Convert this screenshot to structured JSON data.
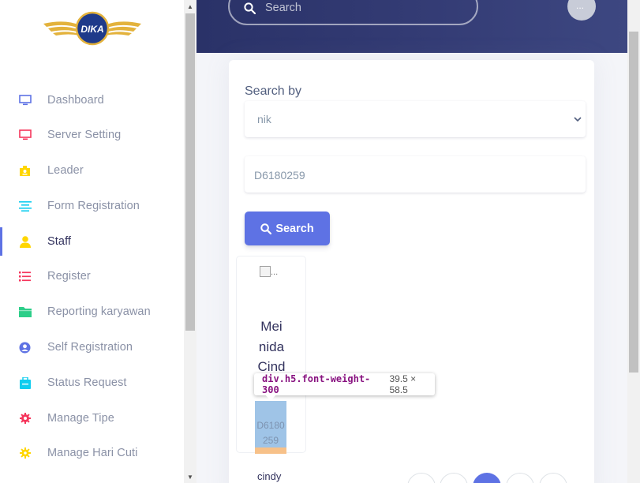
{
  "brand": {
    "logo_text": "DIKA"
  },
  "sidebar": {
    "items": [
      {
        "label": "Dashboard",
        "icon": "tv-icon",
        "color": "#5e72e4"
      },
      {
        "label": "Server Setting",
        "icon": "monitor-icon",
        "color": "#f5365c"
      },
      {
        "label": "Leader",
        "icon": "badge-icon",
        "color": "#ffd600"
      },
      {
        "label": "Form Registration",
        "icon": "align-center-icon",
        "color": "#11cdef"
      },
      {
        "label": "Staff",
        "icon": "user-icon",
        "color": "#ffd600",
        "active": true
      },
      {
        "label": "Register",
        "icon": "list-icon",
        "color": "#f5365c"
      },
      {
        "label": "Reporting karyawan",
        "icon": "folder-icon",
        "color": "#2dce89"
      },
      {
        "label": "Self Registration",
        "icon": "user-circle-icon",
        "color": "#5e72e4"
      },
      {
        "label": "Status Request",
        "icon": "briefcase-icon",
        "color": "#11cdef"
      },
      {
        "label": "Manage Tipe",
        "icon": "settings-gear-icon",
        "color": "#f5365c"
      },
      {
        "label": "Manage Hari Cuti",
        "icon": "sun-icon",
        "color": "#ffd600"
      }
    ]
  },
  "header": {
    "search_placeholder": "Search",
    "avatar_alt": "..."
  },
  "form": {
    "search_by_label": "Search by",
    "search_by_value": "nik",
    "query_value": "D6180259",
    "search_button": "Search"
  },
  "results": {
    "staff": [
      {
        "name": "Mei nida Cind",
        "nik": "D6180 259",
        "image_alt": "..."
      }
    ],
    "next_name": "cindy"
  },
  "devtools_tooltip": {
    "selector": "div.h5.font-weight-300",
    "dimensions": "39.5 × 58.5"
  },
  "colors": {
    "primary": "#5e72e4",
    "header_bg": "#2a3268",
    "text_muted": "#8a91a6"
  }
}
